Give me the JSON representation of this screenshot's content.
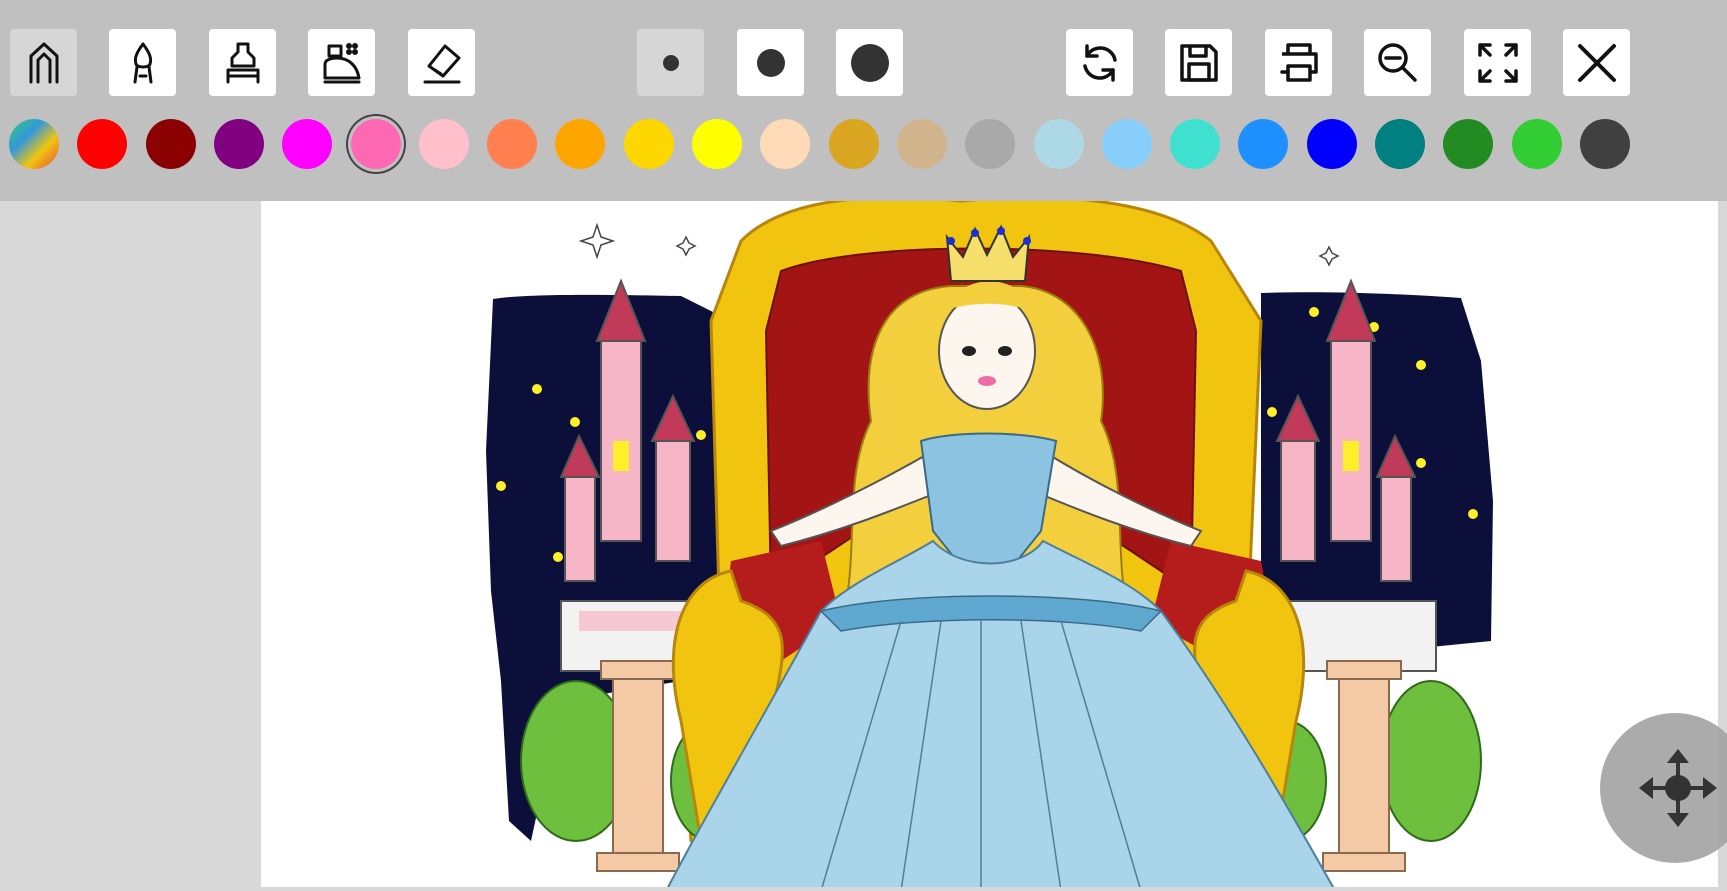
{
  "toolbar": {
    "tools": [
      {
        "name": "pencil-tool",
        "icon": "pencil-icon",
        "active": true
      },
      {
        "name": "brush-tool",
        "icon": "brush-icon",
        "active": false
      },
      {
        "name": "marker-tool",
        "icon": "marker-icon",
        "active": false
      },
      {
        "name": "spray-tool",
        "icon": "spray-icon",
        "active": false
      },
      {
        "name": "eraser-tool",
        "icon": "eraser-icon",
        "active": false
      }
    ],
    "brush_sizes": [
      {
        "name": "small",
        "selected": true
      },
      {
        "name": "medium",
        "selected": false
      },
      {
        "name": "large",
        "selected": false
      }
    ],
    "actions": [
      {
        "name": "reset",
        "icon": "refresh-icon"
      },
      {
        "name": "save",
        "icon": "save-icon"
      },
      {
        "name": "print",
        "icon": "print-icon"
      },
      {
        "name": "zoom-out",
        "icon": "zoom-out-icon"
      },
      {
        "name": "fullscreen",
        "icon": "fullscreen-icon"
      },
      {
        "name": "close",
        "icon": "close-icon"
      }
    ]
  },
  "palette": {
    "selected_index": 5,
    "colors": [
      "rainbow",
      "#ff0000",
      "#8b0000",
      "#800080",
      "#ff00ff",
      "#ff69b4",
      "#ffc0cb",
      "#ff7f50",
      "#ffa500",
      "#ffd700",
      "#ffff00",
      "#ffdab9",
      "#daa520",
      "#d2b48c",
      "#a9a9a9",
      "#add8e6",
      "#87cefa",
      "#40e0d0",
      "#1e90ff",
      "#0000ff",
      "#008080",
      "#228b22",
      "#32cd32",
      "#404040"
    ]
  },
  "canvas": {
    "image": "princess-on-throne-coloring-page",
    "colors": {
      "night_sky": "#0b0f3a",
      "throne_gold": "#f1c40f",
      "throne_red": "#a31515",
      "dress_blue": "#a9d4ea",
      "hair": "#f3cf3d",
      "castle_pink": "#f7b6c8",
      "tower_roof": "#c23a5a",
      "trees": "#6fbf3f",
      "pillar": "#f3c9a6"
    }
  },
  "move_control": {
    "icon": "move-arrows-icon"
  }
}
